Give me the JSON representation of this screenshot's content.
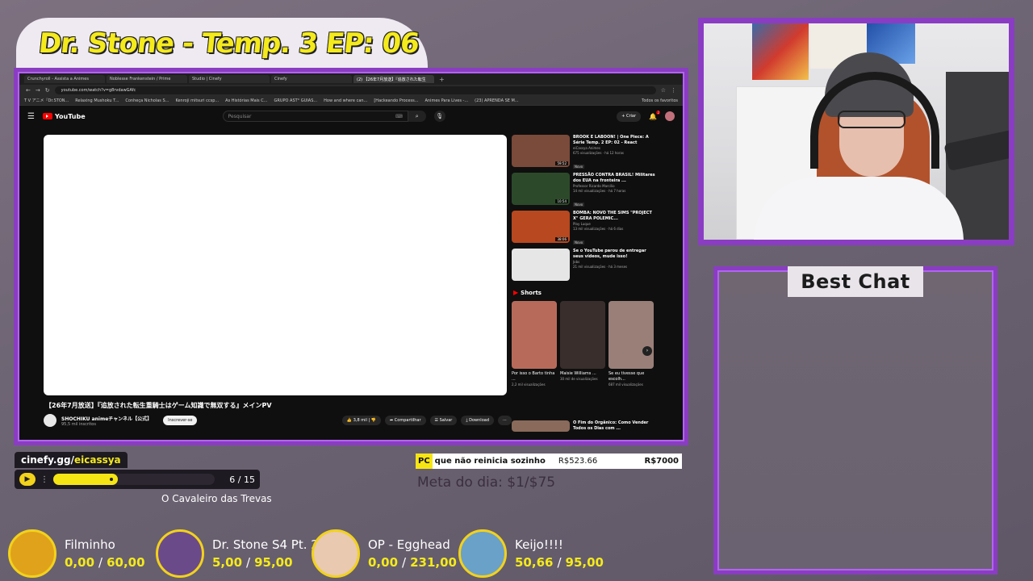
{
  "overlay": {
    "title": "Dr. Stone - Temp. 3 EP: 06"
  },
  "browser": {
    "tabs": [
      {
        "label": "Crunchyroll - Assista a Animes",
        "active": false
      },
      {
        "label": "Noblesse Frankenstein / Prime",
        "active": false
      },
      {
        "label": "Studio | Cinefy",
        "active": false
      },
      {
        "label": "Cinefy",
        "active": false
      },
      {
        "label": "(2) 【26年7月放送】『追放された転生",
        "active": true
      }
    ],
    "url": "youtube.com/watch?v=g8rvdawGAfc",
    "bookmarks": [
      "T V アニメ『Dr.STON...",
      "Relaxing Mushoku T...",
      "Conheça Nicholas S...",
      "Kenroji mitsuri ccsp...",
      "As Histórias Mais C...",
      "GRUPO AST° GUIAS...",
      "How and where can...",
      "[Hackeando Process...",
      "Animes Para Lives -...",
      "(23) APRENDA SE M..."
    ],
    "bookmarks_right": "Todos os favoritos"
  },
  "youtube": {
    "logo": "YouTube",
    "search_placeholder": "Pesquisar",
    "create_label": "+ Criar",
    "notif_count": "2",
    "video_title": "【26年7月放送】『追放された転生重騎士はゲーム知識で無双する』メインPV",
    "channel_name": "SHOCHIKU animeチャンネル【公式】",
    "channel_subs": "95,5 mil inscritos",
    "subscribe_label": "Inscrever-se",
    "likes": "3,8 mil",
    "share_label": "Compartilhar",
    "save_label": "Salvar",
    "download_label": "Download",
    "shorts_label": "Shorts",
    "recommendations": [
      {
        "title": "BROOK E LABOON! | One Piece: A Série Temp. 2 EP: 02 - React",
        "channel": "eiCassya Animes",
        "meta": "675 visualizações · há 12 horas",
        "badge": "Novo",
        "duration": "59:52",
        "color": "#7a4a3a"
      },
      {
        "title": "PRESSÃO CONTRA BRASIL! Militares dos EUA na fronteira ...",
        "channel": "Professor Ricardo Marcílio",
        "meta": "14 mil visualizações · há 7 horas",
        "badge": "Novo",
        "duration": "10:54",
        "color": "#2c4a2a"
      },
      {
        "title": "BOMBA: NOVO THE SIMS \"PROJECT X\" GERA POLEMIC...",
        "channel": "Play Luque",
        "meta": "13 mil visualizações · há 6 dias",
        "badge": "Novo",
        "duration": "38:06",
        "color": "#b8481f"
      },
      {
        "title": "Se o YouTube parou de entregar seus vídeos, mude isso!",
        "channel": "Jobs",
        "meta": "21 mil visualizações · há 3 meses",
        "badge": "",
        "duration": "",
        "color": "#e6e6e6"
      }
    ],
    "shorts": [
      {
        "title": "Por isso o Barto tinha ...",
        "views": "2,2 mil visualizações",
        "color": "#b86a5a"
      },
      {
        "title": "Maisie Williams ...",
        "views": "30 mil de visualizações",
        "color": "#3a2e2c"
      },
      {
        "title": "Se eu tivesse que escolh...",
        "views": "687 mil visualizações",
        "color": "#9a7f78"
      }
    ],
    "partial_rec_title": "O Fim do Orgânico: Como Vender Todos os Dias com ..."
  },
  "chat": {
    "title": "Best Chat"
  },
  "cinefy": {
    "host": "cinefy.gg/",
    "user": "eicassya",
    "episode_current": "6",
    "episode_sep": " / ",
    "episode_total": "15",
    "progress": 0.4,
    "movie_title": "O Cavaleiro das Trevas"
  },
  "goal": {
    "highlight": "PC",
    "label": " que não reinicia sozinho",
    "current": "R$523.66",
    "target": "R$7000",
    "daily_meta": "Meta do dia: $1/$75"
  },
  "counters": [
    {
      "name": "Filminho",
      "current": "0,00",
      "total": "60,00",
      "icon": "film-reel-icon",
      "color": "#e0a21b"
    },
    {
      "name": "Dr. Stone S4 Pt. 2",
      "current": "5,00",
      "total": "95,00",
      "icon": "dr-stone-icon",
      "color": "#6b4a8a"
    },
    {
      "name": "OP - Egghead",
      "current": "0,00",
      "total": "231,00",
      "icon": "op-egghead-icon",
      "color": "#e9c9b0"
    },
    {
      "name": "Keijo!!!!",
      "current": "50,66",
      "total": "95,00",
      "icon": "keijo-icon",
      "color": "#6aa1c8"
    }
  ],
  "colors": {
    "frame": "#8a3dc2",
    "accent": "#f4ea1c"
  }
}
